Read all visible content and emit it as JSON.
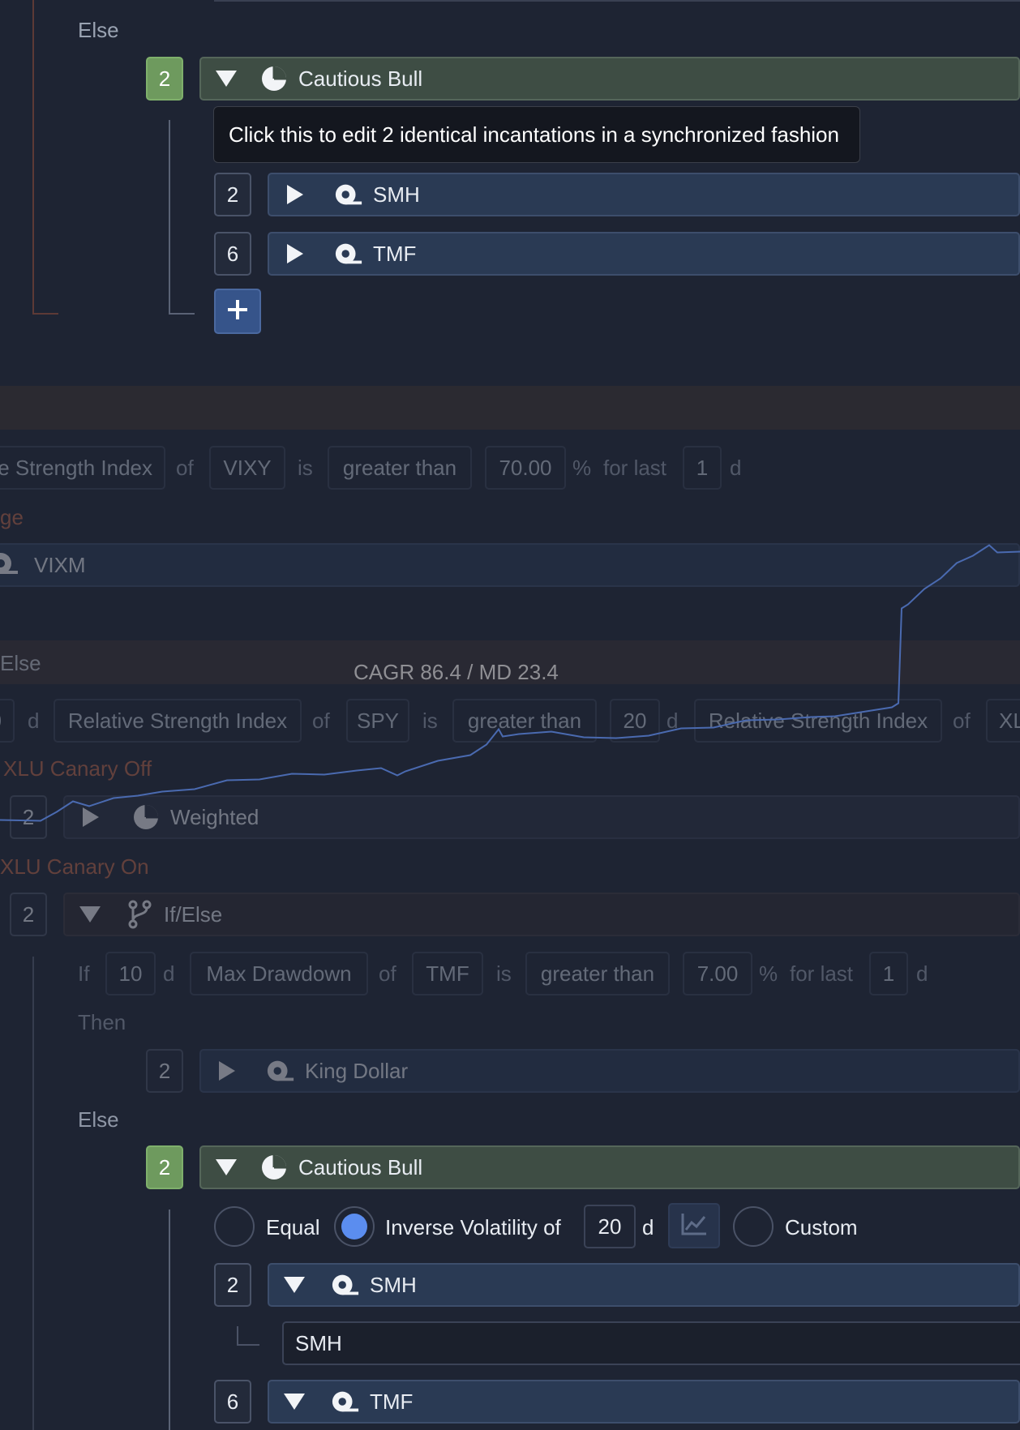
{
  "top_block": {
    "else_label": "Else",
    "weight_badge": "2",
    "group_name": "Cautious Bull",
    "tooltip": "Click this to edit 2 identical incantations in a synchronized fashion",
    "items": [
      {
        "weight": "2",
        "ticker": "SMH"
      },
      {
        "weight": "6",
        "ticker": "TMF"
      }
    ]
  },
  "condition_row": {
    "indicator": "e Strength Index",
    "of": "of",
    "ticker": "VIXY",
    "is": "is",
    "comparator": "greater than",
    "value": "70.00",
    "unit": "%",
    "for_last": "for last",
    "days": "1",
    "d": "d"
  },
  "then_label_partial": "ge",
  "vixm_ticker": "VIXM",
  "else_label_2": "Else",
  "chart_label": "CAGR 86.4 / MD 23.4",
  "rsi_row": {
    "days_partial": "0",
    "d": "d",
    "indicator1": "Relative Strength Index",
    "of1": "of",
    "ticker1": "SPY",
    "is": "is",
    "comparator": "greater than",
    "value": "20",
    "d2": "d",
    "indicator2": "Relative Strength Index",
    "of2": "of",
    "ticker2_partial": "XL"
  },
  "canary_off": "XLU Canary Off",
  "weighted_block": {
    "weight": "2",
    "name": "Weighted"
  },
  "canary_on": "XLU Canary On",
  "ifelse_block": {
    "weight": "2",
    "name": "If/Else"
  },
  "drawdown_row": {
    "if": "If",
    "days": "10",
    "d": "d",
    "indicator": "Max Drawdown",
    "of": "of",
    "ticker": "TMF",
    "is": "is",
    "comparator": "greater than",
    "value": "7.00",
    "unit": "%",
    "for_last": "for last",
    "lastdays": "1",
    "d2": "d"
  },
  "then_label": "Then",
  "king_dollar": {
    "weight": "2",
    "name": "King Dollar"
  },
  "else_label_3": "Else",
  "bottom_block": {
    "weight_badge": "2",
    "group_name": "Cautious Bull",
    "opt_equal": "Equal",
    "opt_invvol": "Inverse Volatility of",
    "invvol_days": "20",
    "invvol_d": "d",
    "opt_custom": "Custom",
    "items": [
      {
        "weight": "2",
        "ticker": "SMH",
        "sub": "SMH"
      },
      {
        "weight": "6",
        "ticker": "TMF"
      }
    ]
  },
  "colors": {
    "background": "#1e2433",
    "group_green": "#3e4d44",
    "asset_blue": "#2a3a54",
    "accent_blue": "#5b8def",
    "orange_label": "#c26a4a",
    "chart_line": "#4a6ab0"
  },
  "icons": [
    "pie-chart-icon",
    "asset-target-icon",
    "branch-icon",
    "plus-icon",
    "chart-line-icon"
  ]
}
